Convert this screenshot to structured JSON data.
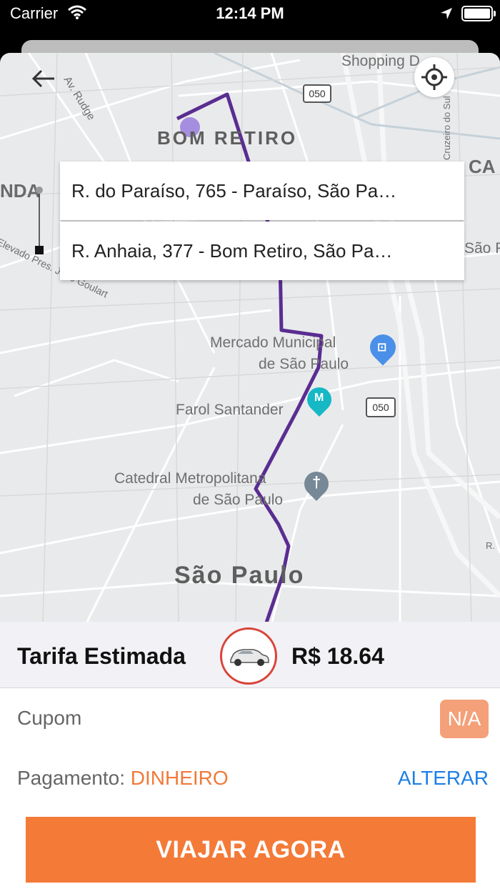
{
  "status_bar": {
    "carrier": "Carrier",
    "time": "12:14 PM"
  },
  "map": {
    "labels": {
      "bom_retiro": "BOM RETIRO",
      "shopping": "Shopping D",
      "mercado_line1": "Mercado Municipal",
      "mercado_line2": "de São Paulo",
      "farol": "Farol Santander",
      "catedral_line1": "Catedral Metropolitana",
      "catedral_line2": "de São Paulo",
      "sao_paulo": "São Paulo",
      "av_rudge": "Av. Rudge",
      "elevado": "Elevado Pres. João Goulart",
      "nda": "NDA",
      "ca": "CA",
      "sao_p": "São P",
      "cruzeiro": "Cruzeiro do Sul",
      "r": "R.",
      "highway_1": "050",
      "highway_2": "050"
    },
    "route_color": "#5a2d91"
  },
  "addresses": {
    "origin": "R. do Paraíso, 765 - Paraíso, São Pa…",
    "destination": "R. Anhaia, 377 - Bom Retiro, São Pa…"
  },
  "fare": {
    "label": "Tarifa Estimada",
    "value": "R$ 18.64"
  },
  "coupon": {
    "label": "Cupom",
    "value": "N/A"
  },
  "payment": {
    "label": "Pagamento:",
    "method": "DINHEIRO",
    "change": "ALTERAR"
  },
  "cta": {
    "label": "VIAJAR AGORA"
  },
  "colors": {
    "accent": "#f47a38",
    "link": "#1e7fe6",
    "car_ring": "#d9443a"
  }
}
